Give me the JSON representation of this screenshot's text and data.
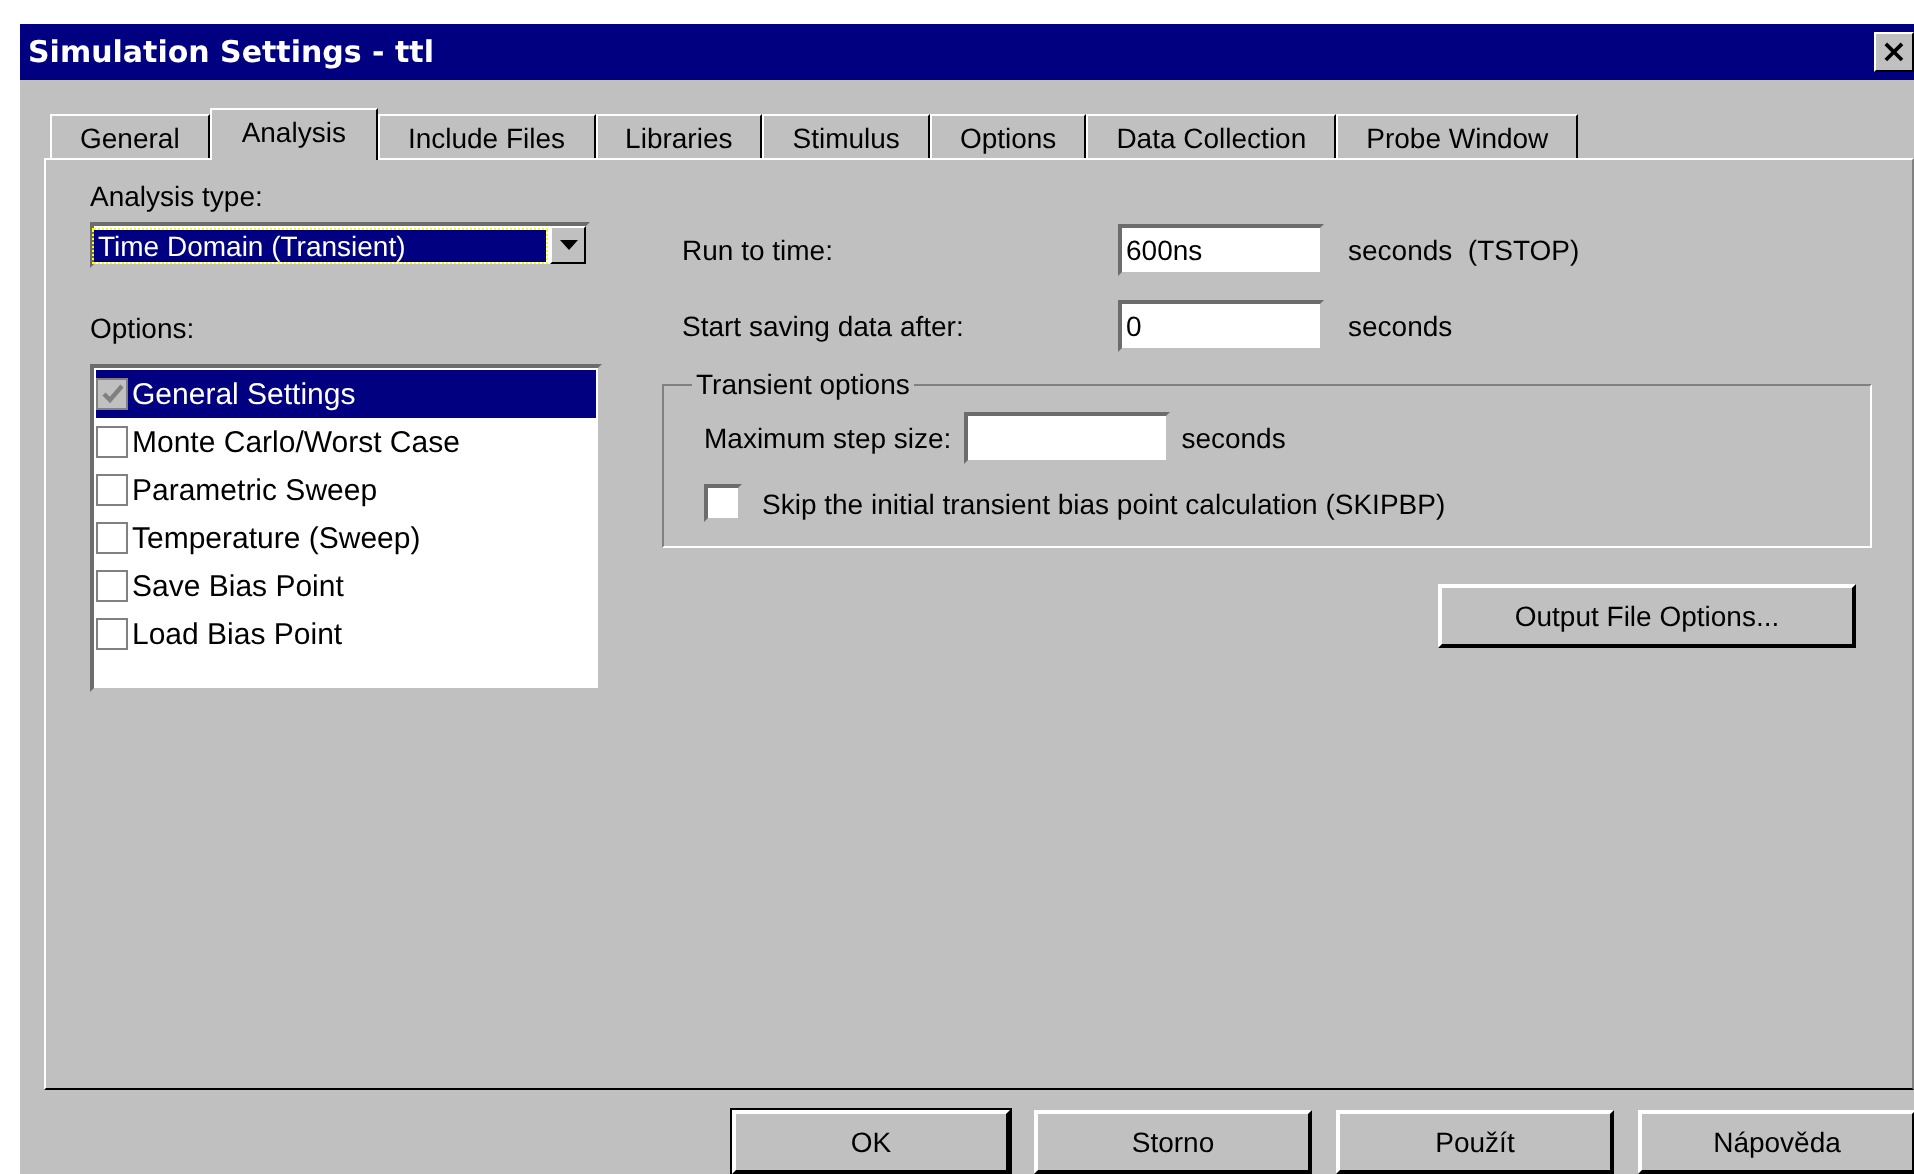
{
  "window": {
    "title": "Simulation Settings - ttl",
    "close": "×"
  },
  "tabs": [
    {
      "label": "General",
      "selected": false
    },
    {
      "label": "Analysis",
      "selected": true
    },
    {
      "label": "Include Files",
      "selected": false
    },
    {
      "label": "Libraries",
      "selected": false
    },
    {
      "label": "Stimulus",
      "selected": false
    },
    {
      "label": "Options",
      "selected": false
    },
    {
      "label": "Data Collection",
      "selected": false
    },
    {
      "label": "Probe Window",
      "selected": false
    }
  ],
  "analysis_type": {
    "label": "Analysis type:",
    "value": "Time Domain (Transient)"
  },
  "options": {
    "label": "Options:",
    "items": [
      {
        "label": "General Settings",
        "checked": true,
        "disabled": true,
        "selected": true
      },
      {
        "label": "Monte Carlo/Worst Case",
        "checked": false,
        "disabled": false,
        "selected": false
      },
      {
        "label": "Parametric Sweep",
        "checked": false,
        "disabled": false,
        "selected": false
      },
      {
        "label": "Temperature (Sweep)",
        "checked": false,
        "disabled": false,
        "selected": false
      },
      {
        "label": "Save Bias Point",
        "checked": false,
        "disabled": false,
        "selected": false
      },
      {
        "label": "Load Bias Point",
        "checked": false,
        "disabled": false,
        "selected": false
      }
    ]
  },
  "run_to_time": {
    "label": "Run to time:",
    "value": "600ns",
    "unit": "seconds  (TSTOP)"
  },
  "start_saving": {
    "label": "Start saving data after:",
    "value": "0",
    "unit": "seconds"
  },
  "transient_options": {
    "title": "Transient options",
    "max_step": {
      "label": "Maximum step size:",
      "unit": "seconds"
    },
    "skip_bias": {
      "label": "Skip the initial transient bias point calculation  (SKIPBP)",
      "checked": false
    }
  },
  "output_button": "Output File Options...",
  "buttons": [
    "OK",
    "Storno",
    "Použít",
    "Nápověda"
  ]
}
